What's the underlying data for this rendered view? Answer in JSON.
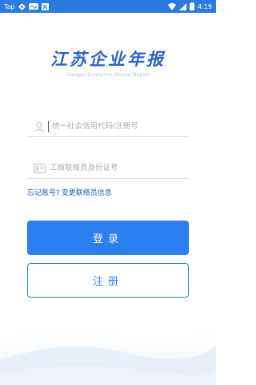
{
  "status_bar": {
    "left_icons": [
      "taptap-icon",
      "game-controller-icon",
      "signal-badge-icon",
      "x-badge-icon"
    ],
    "tap_label": "Tap",
    "time": "4:19"
  },
  "logo": {
    "title": "江苏企业年报",
    "subtitle": "Jiangsu Enterprise Annual Report"
  },
  "form": {
    "credit_code_placeholder": "统一社会信用代码/注册号",
    "id_card_placeholder": "工商联络员身份证号"
  },
  "links": {
    "forgot": "忘记账号?",
    "change_contact": "变更联络员信息"
  },
  "buttons": {
    "login": "登录",
    "register": "注册"
  },
  "colors": {
    "primary": "#2b7ff0",
    "status_bar": "#2b7be0",
    "logo": "#2b64c4"
  }
}
